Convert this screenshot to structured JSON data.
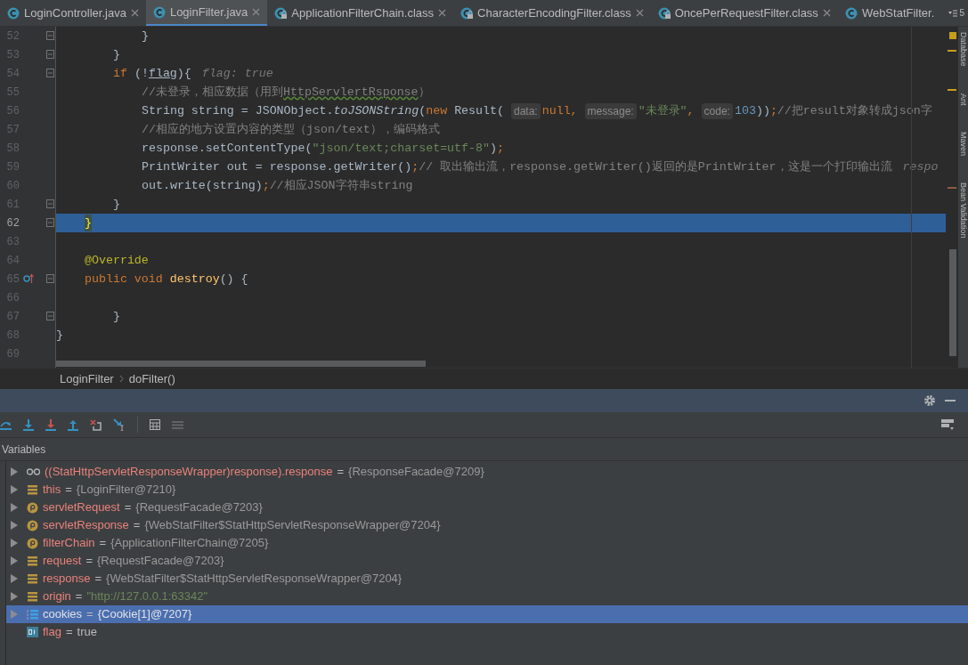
{
  "tabs": [
    {
      "label": "LoginController.java",
      "kind": "class",
      "selected": false,
      "closable": true
    },
    {
      "label": "LoginFilter.java",
      "kind": "class",
      "selected": true,
      "closable": true
    },
    {
      "label": "ApplicationFilterChain.class",
      "kind": "compiled",
      "selected": false,
      "closable": true
    },
    {
      "label": "CharacterEncodingFilter.class",
      "kind": "compiled",
      "selected": false,
      "closable": true
    },
    {
      "label": "OncePerRequestFilter.class",
      "kind": "compiled",
      "selected": false,
      "closable": true
    },
    {
      "label": "WebStatFilter.",
      "kind": "class",
      "selected": false,
      "closable": false
    }
  ],
  "hidden_tabs_count": "5",
  "editor": {
    "lines": [
      {
        "number": "52",
        "fold": true,
        "current": false,
        "tokens": [
          {
            "text": "            }",
            "kind": "plain"
          }
        ]
      },
      {
        "number": "53",
        "fold": true,
        "current": false,
        "tokens": [
          {
            "text": "        }",
            "kind": "plain"
          }
        ]
      },
      {
        "number": "54",
        "fold": true,
        "current": false,
        "tokens": [
          {
            "text": "        if",
            "kind": "keyword"
          },
          {
            "text": " (!",
            "kind": "plain"
          },
          {
            "text": "flag",
            "kind": "ref"
          },
          {
            "text": "){",
            "kind": "plain"
          },
          {
            "text": "flag: true",
            "kind": "inline-value"
          }
        ]
      },
      {
        "number": "55",
        "fold": false,
        "current": false,
        "tokens": [
          {
            "text": "            //未登录，相应数据（用到",
            "kind": "comment"
          },
          {
            "text": "HttpServlertRsponse",
            "kind": "typo"
          },
          {
            "text": "）",
            "kind": "comment"
          }
        ]
      },
      {
        "number": "56",
        "fold": false,
        "current": false,
        "tokens": [
          {
            "text": "            String string = JSONObject.",
            "kind": "plain"
          },
          {
            "text": "toJSONString",
            "kind": "static"
          },
          {
            "text": "(",
            "kind": "plain"
          },
          {
            "text": "new",
            "kind": "keyword"
          },
          {
            "text": " Result(",
            "kind": "plain"
          },
          {
            "text": "data:",
            "kind": "hint"
          },
          {
            "text": "null,",
            "kind": "keyword"
          },
          {
            "text": "message:",
            "kind": "hint"
          },
          {
            "text": "\"未登录\"",
            "kind": "string"
          },
          {
            "text": ",",
            "kind": "keyword"
          },
          {
            "text": "code:",
            "kind": "hint"
          },
          {
            "text": "103",
            "kind": "number"
          },
          {
            "text": "))",
            "kind": "plain"
          },
          {
            "text": ";",
            "kind": "keyword"
          },
          {
            "text": "//把result对象转成json字",
            "kind": "comment"
          }
        ]
      },
      {
        "number": "57",
        "fold": false,
        "current": false,
        "tokens": [
          {
            "text": "            //相应的地方设置内容的类型（json/text），编码格式",
            "kind": "comment"
          }
        ]
      },
      {
        "number": "58",
        "fold": false,
        "current": false,
        "tokens": [
          {
            "text": "            response.setContentType(",
            "kind": "plain"
          },
          {
            "text": "\"json/text;charset=utf-8\"",
            "kind": "string"
          },
          {
            "text": ")",
            "kind": "plain"
          },
          {
            "text": ";",
            "kind": "keyword"
          }
        ]
      },
      {
        "number": "59",
        "fold": false,
        "current": false,
        "tokens": [
          {
            "text": "            PrintWriter out = response.getWriter()",
            "kind": "plain"
          },
          {
            "text": ";",
            "kind": "keyword"
          },
          {
            "text": "// 取出输出流，response.getWriter()返回的是PrintWriter，这是一个打印输出流",
            "kind": "comment"
          },
          {
            "text": "respo",
            "kind": "inline-value"
          }
        ]
      },
      {
        "number": "60",
        "fold": false,
        "current": false,
        "tokens": [
          {
            "text": "            out.write(string)",
            "kind": "plain"
          },
          {
            "text": ";",
            "kind": "keyword"
          },
          {
            "text": "//相应JSON字符串string",
            "kind": "comment"
          }
        ]
      },
      {
        "number": "61",
        "fold": true,
        "current": false,
        "tokens": [
          {
            "text": "        }",
            "kind": "plain"
          }
        ]
      },
      {
        "number": "62",
        "fold": true,
        "current": true,
        "tokens": [
          {
            "text": "    }",
            "kind": "brace-match"
          }
        ]
      },
      {
        "number": "63",
        "fold": false,
        "current": false
      },
      {
        "number": "64",
        "fold": false,
        "current": false,
        "tokens": [
          {
            "text": "    @Override",
            "kind": "annotation"
          }
        ]
      },
      {
        "number": "65",
        "fold": true,
        "current": false,
        "overrides": true,
        "tokens": [
          {
            "text": "    public void",
            "kind": "keyword"
          },
          {
            "text": "destroy",
            "kind": "method"
          },
          {
            "text": "() {",
            "kind": "plain"
          }
        ]
      },
      {
        "number": "66",
        "fold": false,
        "current": false
      },
      {
        "number": "67",
        "fold": true,
        "current": false,
        "tokens": [
          {
            "text": "        }",
            "kind": "plain"
          }
        ]
      },
      {
        "number": "68",
        "fold": false,
        "current": false,
        "tokens": [
          {
            "text": "}",
            "kind": "plain"
          }
        ]
      },
      {
        "number": "69",
        "fold": false,
        "current": false
      }
    ]
  },
  "side_tools": [
    "Database",
    "Ant",
    "Maven",
    "Bean Validation"
  ],
  "breadcrumb": [
    "LoginFilter",
    "doFilter()"
  ],
  "variables": {
    "title": "Variables",
    "rows": [
      {
        "kind": "watch",
        "name": "((StatHttpServletResponseWrapper)response).response",
        "separator": "=",
        "value": {
          "text": "{ResponseFacade@7209}",
          "kind": "object"
        },
        "expandable": true,
        "selected": false
      },
      {
        "kind": "local",
        "name": "this",
        "separator": "=",
        "value": {
          "text": "{LoginFilter@7210}",
          "kind": "object"
        },
        "expandable": true,
        "selected": false
      },
      {
        "kind": "param",
        "name": "servletRequest",
        "separator": "=",
        "value": {
          "text": "{RequestFacade@7203}",
          "kind": "object"
        },
        "expandable": true,
        "selected": false
      },
      {
        "kind": "param",
        "name": "servletResponse",
        "separator": "=",
        "value": {
          "text": "{WebStatFilter$StatHttpServletResponseWrapper@7204}",
          "kind": "object"
        },
        "expandable": true,
        "selected": false
      },
      {
        "kind": "param",
        "name": "filterChain",
        "separator": "=",
        "value": {
          "text": "{ApplicationFilterChain@7205}",
          "kind": "object"
        },
        "expandable": true,
        "selected": false
      },
      {
        "kind": "local",
        "name": "request",
        "separator": "=",
        "value": {
          "text": "{RequestFacade@7203}",
          "kind": "object"
        },
        "expandable": true,
        "selected": false
      },
      {
        "kind": "local",
        "name": "response",
        "separator": "=",
        "value": {
          "text": "{WebStatFilter$StatHttpServletResponseWrapper@7204}",
          "kind": "object"
        },
        "expandable": true,
        "selected": false
      },
      {
        "kind": "local",
        "name": "origin",
        "separator": "=",
        "value": {
          "text": "\"http://127.0.0.1:63342\"",
          "kind": "string"
        },
        "expandable": true,
        "selected": false
      },
      {
        "kind": "array",
        "name": "cookies",
        "separator": "=",
        "value": {
          "text": "{Cookie[1]@7207}",
          "kind": "object"
        },
        "expandable": true,
        "selected": true
      },
      {
        "kind": "boolean",
        "name": "flag",
        "separator": "=",
        "value": {
          "text": "true",
          "kind": "primitive"
        },
        "expandable": false,
        "selected": false
      }
    ]
  }
}
